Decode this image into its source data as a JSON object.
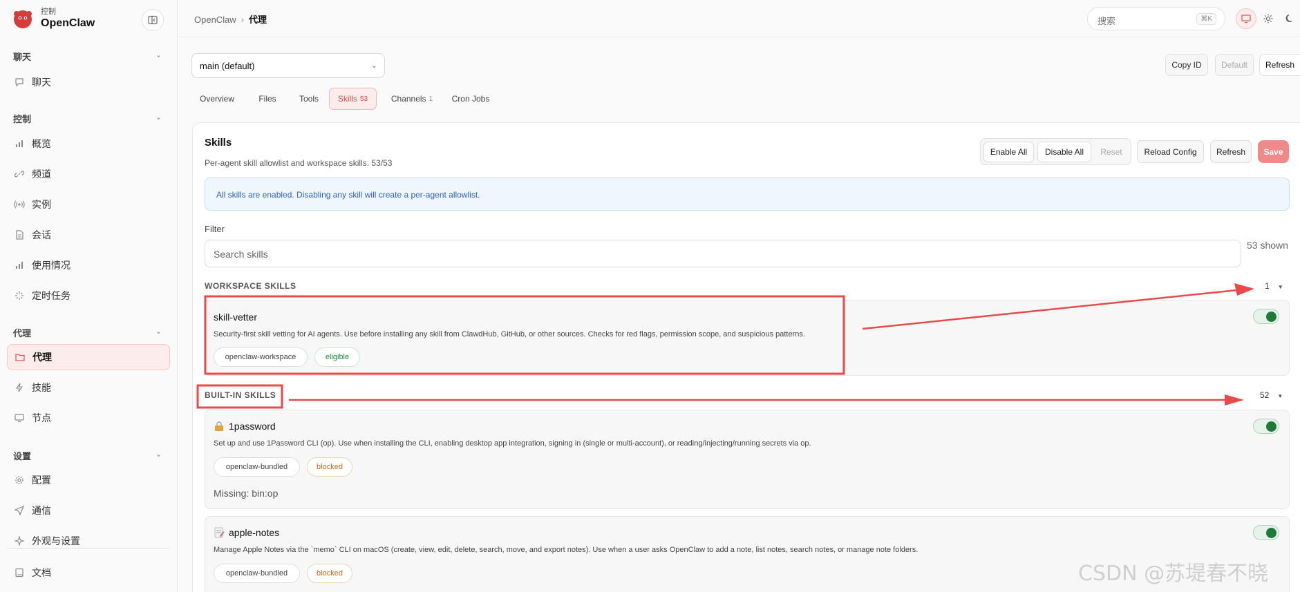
{
  "sidebar": {
    "brand_sub": "控制",
    "brand_name": "OpenClaw",
    "sections": {
      "chat": "聊天",
      "control": "控制",
      "agent": "代理",
      "settings": "设置"
    },
    "items": {
      "chat": "聊天",
      "overview": "概览",
      "channels": "频道",
      "instances": "实例",
      "sessions": "会话",
      "usage": "使用情况",
      "cron": "定时任务",
      "agents": "代理",
      "skills": "技能",
      "nodes": "节点",
      "config": "配置",
      "comms": "通信",
      "appearance": "外观与设置",
      "docs": "文档"
    }
  },
  "topbar": {
    "crumb_root": "OpenClaw",
    "crumb_current": "代理",
    "search_placeholder": "搜索",
    "search_kbd": "⌘K"
  },
  "agent_select": {
    "value": "main (default)"
  },
  "page_buttons": {
    "copy_id": "Copy ID",
    "default": "Default",
    "refresh": "Refresh"
  },
  "tabs": [
    {
      "label": "Overview",
      "count": ""
    },
    {
      "label": "Files",
      "count": ""
    },
    {
      "label": "Tools",
      "count": ""
    },
    {
      "label": "Skills",
      "count": "53"
    },
    {
      "label": "Channels",
      "count": "1"
    },
    {
      "label": "Cron Jobs",
      "count": ""
    }
  ],
  "skills_panel": {
    "title": "Skills",
    "subtitle": "Per-agent skill allowlist and workspace skills. 53/53",
    "buttons": {
      "enable_all": "Enable All",
      "disable_all": "Disable All",
      "reset": "Reset",
      "reload": "Reload Config",
      "refresh": "Refresh",
      "save": "Save"
    },
    "notice": "All skills are enabled. Disabling any skill will create a per-agent allowlist.",
    "filter_label": "Filter",
    "filter_placeholder": "Search skills",
    "shown": "53 shown",
    "groups": {
      "workspace": {
        "label": "WORKSPACE SKILLS",
        "count": "1"
      },
      "builtin": {
        "label": "BUILT-IN SKILLS",
        "count": "52"
      }
    },
    "skills": [
      {
        "name": "skill-vetter",
        "desc": "Security-first skill vetting for AI agents. Use before installing any skill from ClawdHub, GitHub, or other sources. Checks for red flags, permission scope, and suspicious patterns.",
        "source": "openclaw-workspace",
        "status": "eligible",
        "enabled": true
      },
      {
        "name": "1password",
        "desc": "Set up and use 1Password CLI (op). Use when installing the CLI, enabling desktop app integration, signing in (single or multi-account), or reading/injecting/running secrets via op.",
        "source": "openclaw-bundled",
        "status": "blocked",
        "missing": "Missing: bin:op",
        "enabled": true
      },
      {
        "name": "apple-notes",
        "desc": "Manage Apple Notes via the `memo` CLI on macOS (create, view, edit, delete, search, move, and export notes). Use when a user asks OpenClaw to add a note, list notes, search notes, or manage note folders.",
        "source": "openclaw-bundled",
        "status": "blocked",
        "enabled": true
      }
    ]
  },
  "watermark": "CSDN @苏堤春不晓",
  "colors": {
    "accent": "#e05555",
    "toggle_on": "#1f7a3a",
    "annotation": "#e84a4a"
  }
}
